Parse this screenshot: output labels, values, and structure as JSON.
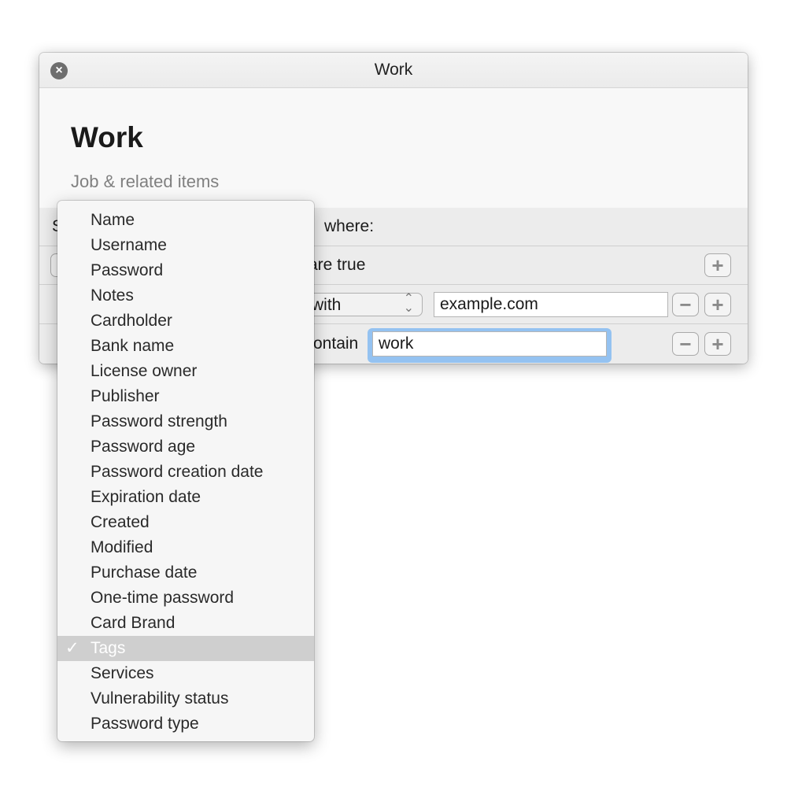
{
  "window": {
    "title": "Work"
  },
  "header": {
    "title": "Work",
    "subtitle": "Job & related items"
  },
  "rows": {
    "search_prefix": "S",
    "where": "where:",
    "match_suffix": "are true",
    "rule1": {
      "operator": "with",
      "value": "example.com"
    },
    "rule2": {
      "operator": "ontain",
      "value": "work"
    }
  },
  "menu": {
    "items": [
      {
        "label": "Name"
      },
      {
        "label": "Username"
      },
      {
        "label": "Password"
      },
      {
        "label": "Notes"
      },
      {
        "label": "Cardholder"
      },
      {
        "label": "Bank name"
      },
      {
        "label": "License owner"
      },
      {
        "label": "Publisher"
      },
      {
        "label": "Password strength"
      },
      {
        "label": "Password age"
      },
      {
        "label": "Password creation date"
      },
      {
        "label": "Expiration date"
      },
      {
        "label": "Created"
      },
      {
        "label": "Modified"
      },
      {
        "label": "Purchase date"
      },
      {
        "label": "One-time password"
      },
      {
        "label": "Card Brand"
      },
      {
        "label": "Tags",
        "selected": true
      },
      {
        "label": "Services"
      },
      {
        "label": "Vulnerability status"
      },
      {
        "label": "Password type"
      }
    ],
    "check": "✓"
  },
  "icons": {
    "close": "close-icon",
    "plus": "+",
    "minus": "−"
  },
  "colors": {
    "focus_ring": "#94c2f1",
    "selected_item": "#cfcfcf"
  }
}
